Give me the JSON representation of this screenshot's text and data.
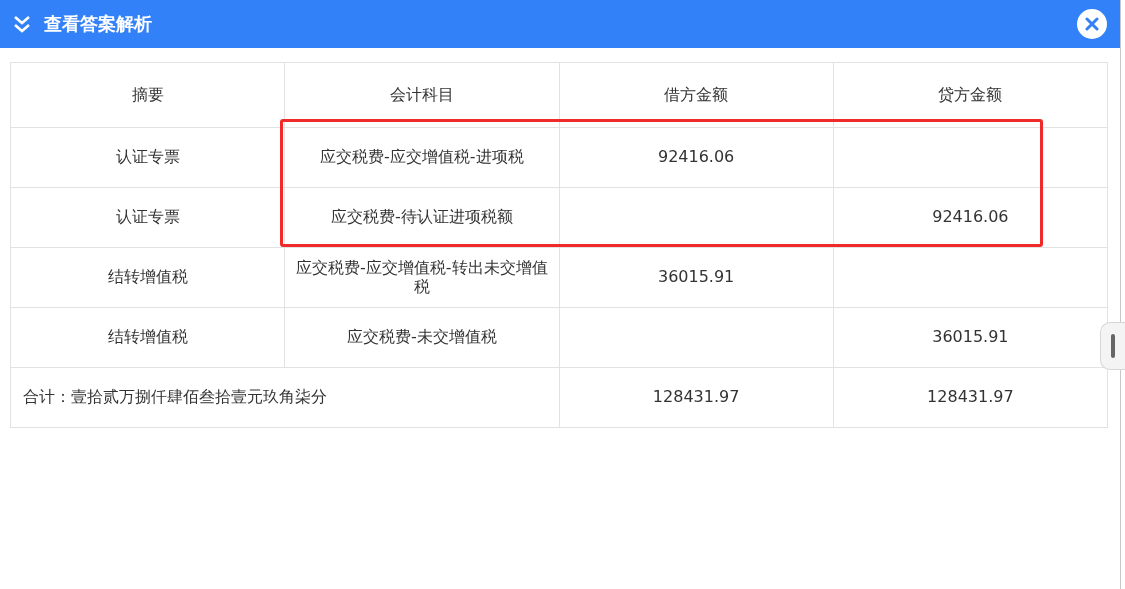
{
  "dialog": {
    "title": "查看答案解析"
  },
  "table": {
    "columns": [
      "摘要",
      "会计科目",
      "借方金额",
      "贷方金额"
    ],
    "rows": [
      {
        "summary": "认证专票",
        "account": "应交税费-应交增值税-进项税",
        "debit": "92416.06",
        "credit": "",
        "highlighted": true
      },
      {
        "summary": "认证专票",
        "account": "应交税费-待认证进项税额",
        "debit": "",
        "credit": "92416.06",
        "highlighted": true
      },
      {
        "summary": "结转增值税",
        "account": "应交税费-应交增值税-转出未交增值税",
        "debit": "36015.91",
        "credit": "",
        "highlighted": false
      },
      {
        "summary": "结转增值税",
        "account": "应交税费-未交增值税",
        "debit": "",
        "credit": "36015.91",
        "highlighted": false
      }
    ],
    "total": {
      "label": "合计：壹拾贰万捌仟肆佰叁拾壹元玖角柒分",
      "debit": "128431.97",
      "credit": "128431.97"
    }
  }
}
